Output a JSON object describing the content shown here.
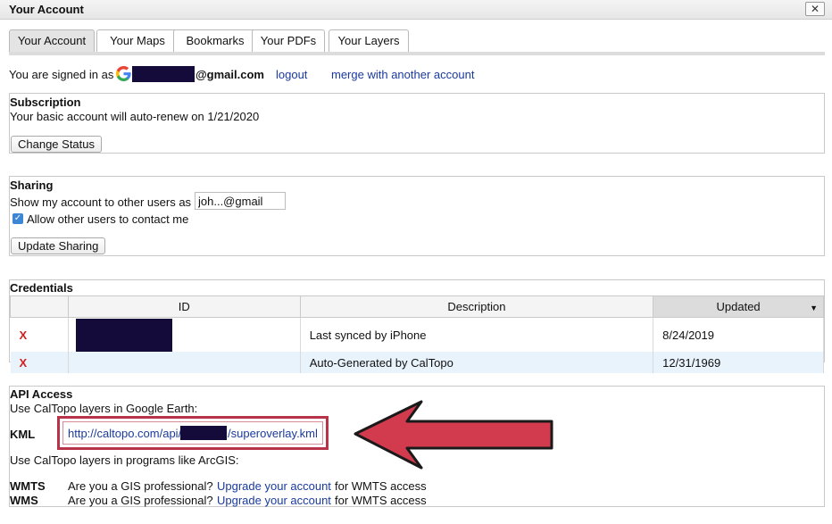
{
  "window": {
    "title": "Your Account",
    "close_label": "✕"
  },
  "tabs": [
    {
      "label": "Your Account",
      "active": true
    },
    {
      "label": "Your Maps"
    },
    {
      "label": "Bookmarks"
    },
    {
      "label": "Your PDFs"
    },
    {
      "label": "Your Layers"
    }
  ],
  "account": {
    "signed_in_text": "You are signed in as",
    "email_suffix": "@gmail.com",
    "logout_label": "logout",
    "merge_label": "merge with another account"
  },
  "subscription": {
    "title": "Subscription",
    "text": "Your basic account will auto-renew on 1/21/2020",
    "button_label": "Change Status"
  },
  "sharing": {
    "title": "Sharing",
    "show_label": "Show my account to other users as",
    "display_name_value": "joh...@gmail",
    "allow_contact_label": "Allow other users to contact me",
    "allow_contact_checked": true,
    "button_label": "Update Sharing"
  },
  "credentials": {
    "title": "Credentials",
    "columns": [
      "ID",
      "Description",
      "Updated"
    ],
    "sorted_column": "Updated",
    "rows": [
      {
        "delete": "X",
        "description": "Last synced by iPhone",
        "updated": "8/24/2019"
      },
      {
        "delete": "X",
        "description": "Auto-Generated by CalTopo",
        "updated": "12/31/1969"
      }
    ]
  },
  "api": {
    "title": "API Access",
    "google_earth_text": "Use CalTopo layers in Google Earth:",
    "kml_label": "KML",
    "kml_url_prefix": "http://caltopo.com/api/",
    "kml_url_suffix": "/superoverlay.kml",
    "arcgis_text": "Use CalTopo layers in programs like ArcGIS:",
    "services": [
      {
        "label": "WMTS",
        "question": "Are you a GIS professional?",
        "link": "Upgrade your account",
        "tail": "for WMTS access"
      },
      {
        "label": "WMS",
        "question": "Are you a GIS professional?",
        "link": "Upgrade your account",
        "tail": "for WMTS access"
      }
    ]
  },
  "colors": {
    "link": "#1a3a9e",
    "delete": "#d11f1f",
    "highlight_box": "#b8324a",
    "arrow": "#d23a4e",
    "redaction": "#140b3b"
  },
  "icons": [
    "google-logo-icon",
    "close-icon",
    "checkbox-checked-icon",
    "sort-caret-icon",
    "arrow-annotation-icon"
  ]
}
